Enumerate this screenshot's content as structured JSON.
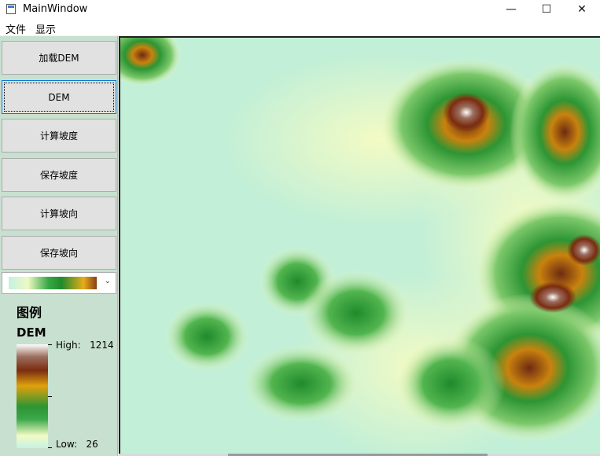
{
  "window": {
    "title": "MainWindow",
    "minimize_glyph": "—",
    "maximize_glyph": "☐",
    "close_glyph": "✕",
    "icon": "window-app-icon"
  },
  "menu": [
    "文件",
    "显示"
  ],
  "buttons": [
    {
      "label": "加载DEM"
    },
    {
      "label": "DEM"
    },
    {
      "label": "计算坡度"
    },
    {
      "label": "保存坡度"
    },
    {
      "label": "计算坡向"
    },
    {
      "label": "保存坡向"
    }
  ],
  "color_ramp_combo": {
    "selected": "green-yellow-brown elevation ramp",
    "arrow": "⌄"
  },
  "legend": {
    "title": "图例",
    "layer": "DEM",
    "high_label": "High:",
    "high_value": "1214",
    "low_label": "Low:",
    "low_value": "26"
  },
  "colors": {
    "panel_bg": "#c8e0cf",
    "button_bg": "#e1e1e1",
    "focus_border": "#0078d7",
    "dem_low": "#bfeed6",
    "dem_mid_low": "#f3fbc4",
    "dem_green": "#2d9534",
    "dem_yellow": "#e0a10c",
    "dem_brown": "#7a2c10",
    "dem_high": "#ffffff"
  }
}
